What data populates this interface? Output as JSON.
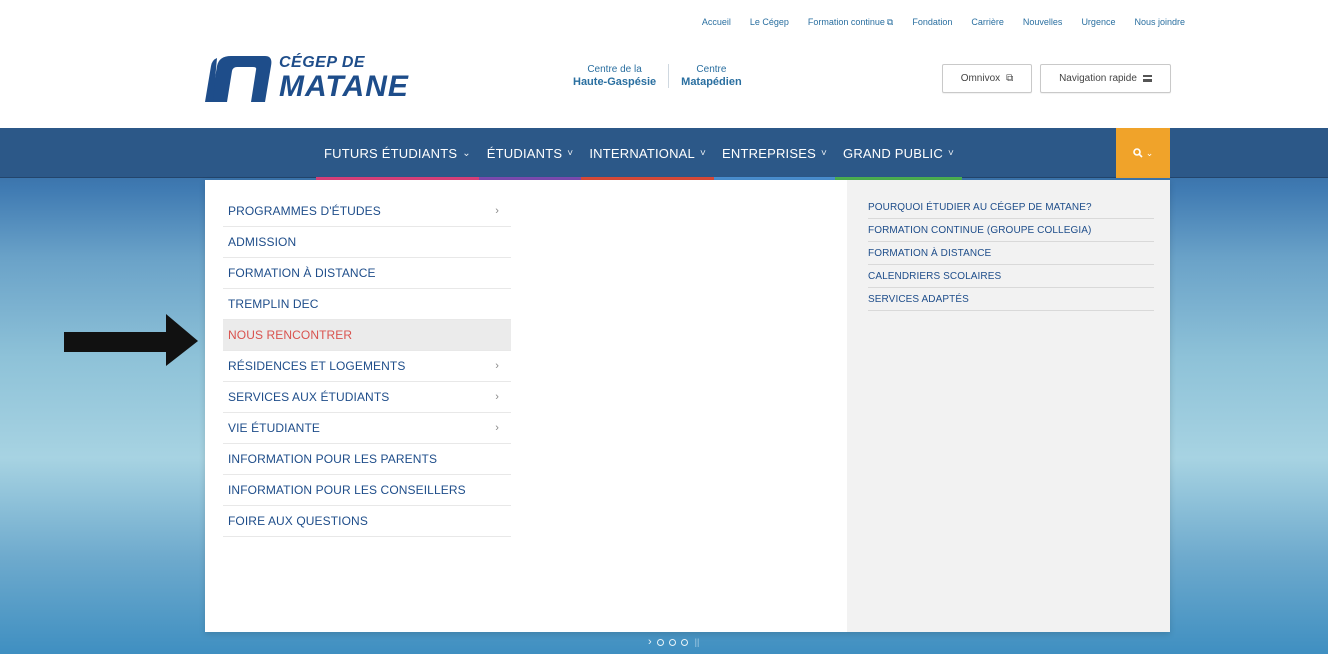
{
  "util_links": [
    "Accueil",
    "Le Cégep",
    "Formation continue",
    "Fondation",
    "Carrière",
    "Nouvelles",
    "Urgence",
    "Nous joindre"
  ],
  "logo": {
    "top": "CÉGEP DE",
    "main": "MATANE"
  },
  "centres": [
    {
      "small": "Centre de la",
      "big": "Haute-Gaspésie"
    },
    {
      "small": "Centre",
      "big": "Matapédien"
    }
  ],
  "header_buttons": {
    "omnivox": "Omnivox",
    "nav_rapide": "Navigation rapide"
  },
  "nav": {
    "items": [
      {
        "label": "FUTURS ÉTUDIANTS",
        "chevron": "⌄",
        "color": "#d9407a"
      },
      {
        "label": "ÉTUDIANTS",
        "chevron": "˅",
        "color": "#7b4bb0"
      },
      {
        "label": "INTERNATIONAL",
        "chevron": "˅",
        "color": "#d94a38"
      },
      {
        "label": "ENTREPRISES",
        "chevron": "˅",
        "color": "#4a8fd0"
      },
      {
        "label": "GRAND PUBLIC",
        "chevron": "˅",
        "color": "#4cb050"
      }
    ],
    "search_icon": "search-icon",
    "search_glyph": "⌕⌄"
  },
  "dropdown": {
    "left_items": [
      {
        "label": "PROGRAMMES D'ÉTUDES",
        "arrow": "›"
      },
      {
        "label": "ADMISSION",
        "arrow": ""
      },
      {
        "label": "FORMATION À DISTANCE",
        "arrow": ""
      },
      {
        "label": "TREMPLIN DEC",
        "arrow": ""
      },
      {
        "label": "NOUS RENCONTRER",
        "arrow": "",
        "highlighted": true
      },
      {
        "label": "RÉSIDENCES ET LOGEMENTS",
        "arrow": "›"
      },
      {
        "label": "SERVICES AUX ÉTUDIANTS",
        "arrow": "›"
      },
      {
        "label": "VIE ÉTUDIANTE",
        "arrow": "›"
      },
      {
        "label": "INFORMATION POUR LES PARENTS",
        "arrow": ""
      },
      {
        "label": "INFORMATION POUR LES CONSEILLERS",
        "arrow": ""
      },
      {
        "label": "FOIRE AUX QUESTIONS",
        "arrow": ""
      }
    ],
    "right_items": [
      "POURQUOI ÉTUDIER AU CÉGEP DE MATANE?",
      "FORMATION CONTINUE (GROUPE COLLEGIA)",
      "FORMATION À DISTANCE",
      "CALENDRIERS SCOLAIRES",
      "SERVICES ADAPTÉS"
    ]
  },
  "carousel": {
    "next": "›",
    "dots": 3,
    "pause": "||"
  },
  "colors": {
    "brand": "#1e4d8a",
    "nav_bg": "#2c5888",
    "search_bg": "#f0a32a",
    "highlight_text": "#d9534f"
  }
}
